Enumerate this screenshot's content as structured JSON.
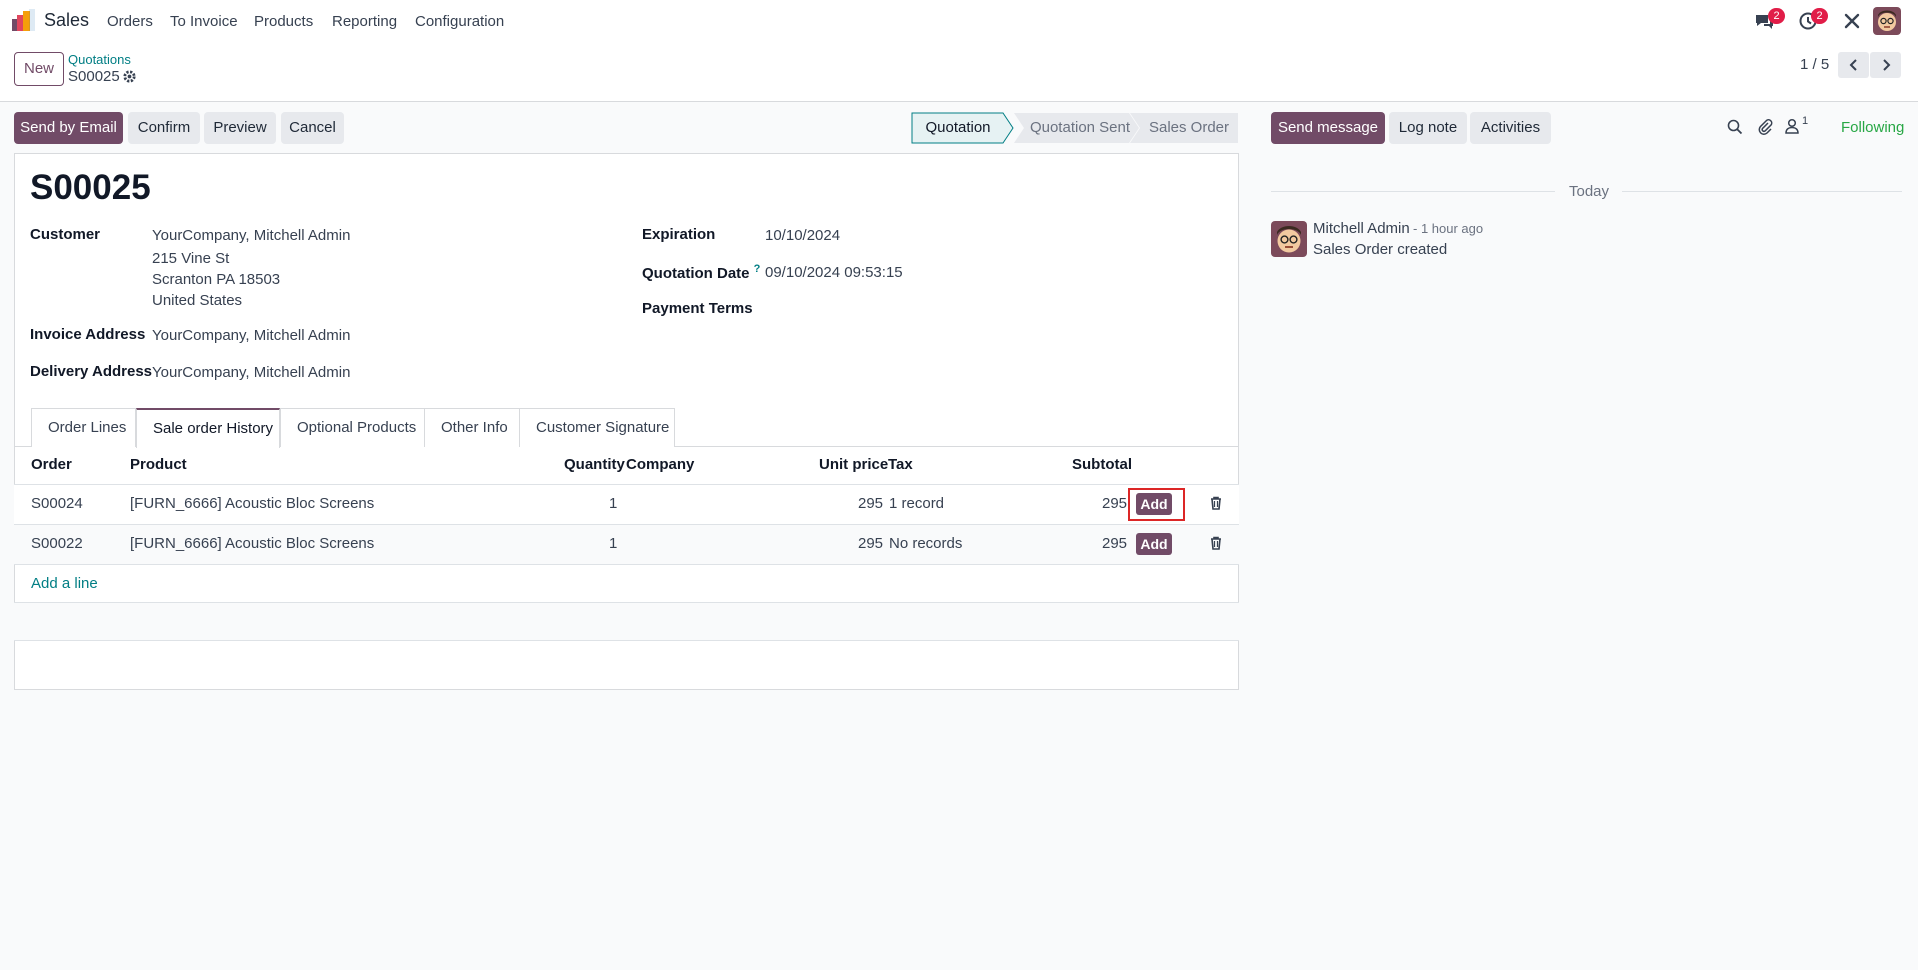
{
  "app": {
    "name": "Sales"
  },
  "menu": [
    "Orders",
    "To Invoice",
    "Products",
    "Reporting",
    "Configuration"
  ],
  "systray": {
    "messages_badge": "2",
    "activities_badge": "2",
    "icons": [
      "chat-icon",
      "clock-icon",
      "tools-icon",
      "user-avatar"
    ]
  },
  "control_panel": {
    "new_label": "New",
    "breadcrumb_parent": "Quotations",
    "breadcrumb_current": "S00025",
    "pager": "1 / 5"
  },
  "actions": {
    "send_by_email": "Send by Email",
    "confirm": "Confirm",
    "preview": "Preview",
    "cancel": "Cancel"
  },
  "status_stages": [
    "Quotation",
    "Quotation Sent",
    "Sales Order"
  ],
  "active_stage": "Quotation",
  "record": {
    "title": "S00025",
    "customer_label": "Customer",
    "customer_name": "YourCompany, Mitchell Admin",
    "customer_street": "215 Vine St",
    "customer_city": "Scranton PA 18503",
    "customer_country": "United States",
    "invoice_address_label": "Invoice Address",
    "invoice_address": "YourCompany, Mitchell Admin",
    "delivery_address_label": "Delivery Address",
    "delivery_address": "YourCompany, Mitchell Admin",
    "expiration_label": "Expiration",
    "expiration": "10/10/2024",
    "quotation_date_label": "Quotation Date",
    "quotation_date_help": "?",
    "quotation_date": "09/10/2024 09:53:15",
    "payment_terms_label": "Payment Terms"
  },
  "tabs": [
    "Order Lines",
    "Sale order History",
    "Optional Products",
    "Other Info",
    "Customer Signature"
  ],
  "active_tab": "Sale order History",
  "table": {
    "headers": {
      "order": "Order",
      "product": "Product",
      "quantity": "Quantity",
      "company": "Company",
      "unit_price": "Unit price",
      "tax": "Tax",
      "subtotal": "Subtotal"
    },
    "rows": [
      {
        "order": "S00024",
        "product": "[FURN_6666] Acoustic Bloc Screens",
        "quantity": "1",
        "company": "",
        "unit_price": "295",
        "tax": "1 record",
        "subtotal": "295",
        "add": "Add"
      },
      {
        "order": "S00022",
        "product": "[FURN_6666] Acoustic Bloc Screens",
        "quantity": "1",
        "company": "",
        "unit_price": "295",
        "tax": "No records",
        "subtotal": "295",
        "add": "Add"
      }
    ],
    "add_line": "Add a line"
  },
  "chatter": {
    "send_message": "Send message",
    "log_note": "Log note",
    "activities": "Activities",
    "followers_count": "1",
    "following": "Following",
    "date_separator": "Today",
    "messages": [
      {
        "author": "Mitchell Admin",
        "time": "- 1 hour ago",
        "body": "Sales Order created"
      }
    ]
  },
  "colors": {
    "brand": "#714b67",
    "link": "#017e84",
    "following": "#28a745",
    "badge": "#e11d48"
  }
}
